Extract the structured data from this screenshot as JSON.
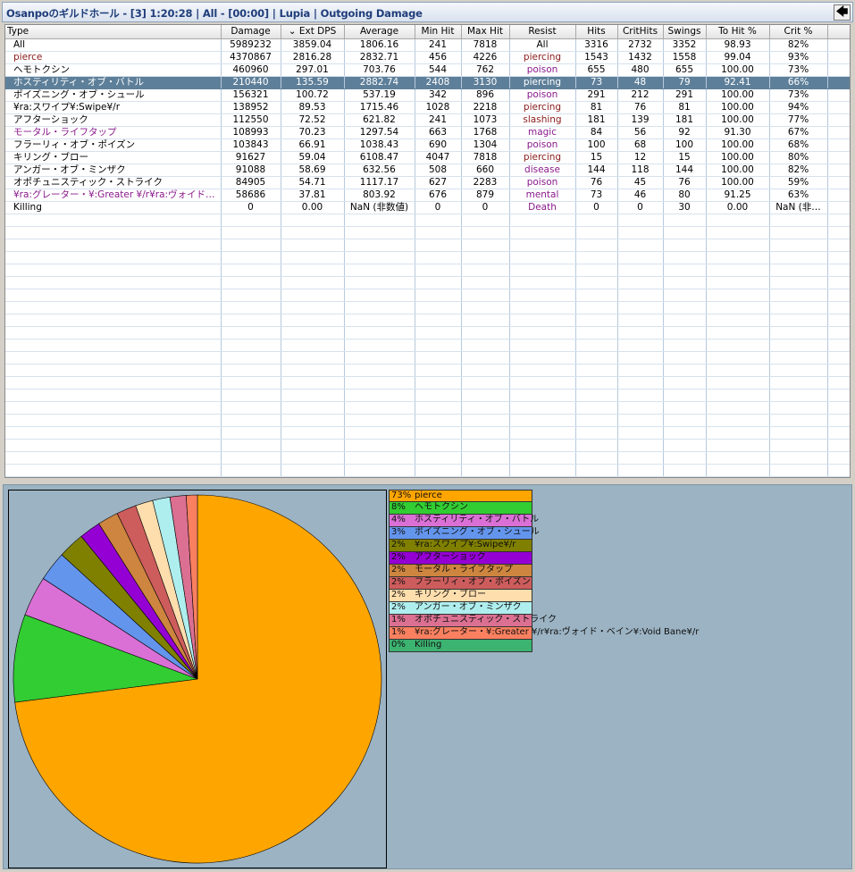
{
  "title": "Osanpoのギルドホール - [3] 1:20:28  | All - [00:00] | Lupia | Outgoing Damage",
  "back_glyph": "🡄",
  "columns": [
    {
      "label": "Type",
      "w": 241
    },
    {
      "label": "Damage",
      "w": 67
    },
    {
      "label": "⌄  Ext DPS",
      "w": 71
    },
    {
      "label": "Average",
      "w": 79
    },
    {
      "label": "Min Hit",
      "w": 52
    },
    {
      "label": "Max Hit",
      "w": 54
    },
    {
      "label": "Resist",
      "w": 74
    },
    {
      "label": "Hits",
      "w": 47
    },
    {
      "label": "CritHits",
      "w": 51
    },
    {
      "label": "Swings",
      "w": 48
    },
    {
      "label": "To Hit %",
      "w": 71
    },
    {
      "label": "Crit %",
      "w": 65
    },
    {
      "label": "",
      "w": 27
    }
  ],
  "rows": [
    {
      "cells": [
        "All",
        "5989232",
        "3859.04",
        "1806.16",
        "241",
        "7818",
        "All",
        "3316",
        "2732",
        "3352",
        "98.93",
        "82%"
      ],
      "name_color": "",
      "resist_color": ""
    },
    {
      "cells": [
        "pierce",
        "4370867",
        "2816.28",
        "2832.71",
        "456",
        "4226",
        "piercing",
        "1543",
        "1432",
        "1558",
        "99.04",
        "93%"
      ],
      "name_color": "maroon",
      "resist_color": "maroon"
    },
    {
      "cells": [
        "ヘモトクシン",
        "460960",
        "297.01",
        "703.76",
        "544",
        "762",
        "poison",
        "655",
        "480",
        "655",
        "100.00",
        "73%"
      ],
      "name_color": "",
      "resist_color": "purple"
    },
    {
      "cells": [
        "ホスティリティ・オブ・バトル",
        "210440",
        "135.59",
        "2882.74",
        "2408",
        "3130",
        "piercing",
        "73",
        "48",
        "79",
        "92.41",
        "66%"
      ],
      "name_color": "",
      "resist_color": "",
      "selected": true
    },
    {
      "cells": [
        "ポイズニング・オブ・シュール",
        "156321",
        "100.72",
        "537.19",
        "342",
        "896",
        "poison",
        "291",
        "212",
        "291",
        "100.00",
        "73%"
      ],
      "name_color": "",
      "resist_color": "purple"
    },
    {
      "cells": [
        "¥ra:スワイプ¥:Swipe¥/r",
        "138952",
        "89.53",
        "1715.46",
        "1028",
        "2218",
        "piercing",
        "81",
        "76",
        "81",
        "100.00",
        "94%"
      ],
      "name_color": "",
      "resist_color": "maroon"
    },
    {
      "cells": [
        "アフターショック",
        "112550",
        "72.52",
        "621.82",
        "241",
        "1073",
        "slashing",
        "181",
        "139",
        "181",
        "100.00",
        "77%"
      ],
      "name_color": "",
      "resist_color": "maroon"
    },
    {
      "cells": [
        "モータル・ライフタップ",
        "108993",
        "70.23",
        "1297.54",
        "663",
        "1768",
        "magic",
        "84",
        "56",
        "92",
        "91.30",
        "67%"
      ],
      "name_color": "purple",
      "resist_color": "purple"
    },
    {
      "cells": [
        "フラーリィ・オブ・ポイズン",
        "103843",
        "66.91",
        "1038.43",
        "690",
        "1304",
        "poison",
        "100",
        "68",
        "100",
        "100.00",
        "68%"
      ],
      "name_color": "",
      "resist_color": "purple"
    },
    {
      "cells": [
        "キリング・ブロー",
        "91627",
        "59.04",
        "6108.47",
        "4047",
        "7818",
        "piercing",
        "15",
        "12",
        "15",
        "100.00",
        "80%"
      ],
      "name_color": "",
      "resist_color": "maroon"
    },
    {
      "cells": [
        "アンガー・オブ・ミンザク",
        "91088",
        "58.69",
        "632.56",
        "508",
        "660",
        "disease",
        "144",
        "118",
        "144",
        "100.00",
        "82%"
      ],
      "name_color": "",
      "resist_color": "purple"
    },
    {
      "cells": [
        "オポチュニスティック・ストライク",
        "84905",
        "54.71",
        "1117.17",
        "627",
        "2283",
        "poison",
        "76",
        "45",
        "76",
        "100.00",
        "59%"
      ],
      "name_color": "",
      "resist_color": "purple"
    },
    {
      "cells": [
        "¥ra:グレーター・¥:Greater ¥/r¥ra:ヴォイド・ベイ…",
        "58686",
        "37.81",
        "803.92",
        "676",
        "879",
        "mental",
        "73",
        "46",
        "80",
        "91.25",
        "63%"
      ],
      "name_color": "purple",
      "resist_color": "purple"
    },
    {
      "cells": [
        "Killing",
        "0",
        "0.00",
        "NaN (非数値)",
        "0",
        "0",
        "Death",
        "0",
        "0",
        "30",
        "0.00",
        "NaN (非…"
      ],
      "name_color": "",
      "resist_color": "purple"
    }
  ],
  "empty_rows": 21,
  "colors": {
    "selected_row": "#5e7f99",
    "purple_text": "#8a1a8c",
    "maroon_text": "#8b1a1a",
    "panel_bg": "#9bb3c3"
  },
  "chart_data": {
    "type": "pie",
    "slices": [
      {
        "label": "pierce",
        "pct_label": "73%",
        "value": 4370867,
        "color": "#ffa500"
      },
      {
        "label": "ヘモトクシン",
        "pct_label": "8%",
        "value": 460960,
        "color": "#32cd32"
      },
      {
        "label": "ホスティリティ・オブ・バトル",
        "pct_label": "4%",
        "value": 210440,
        "color": "#da70d6"
      },
      {
        "label": "ポイズニング・オブ・シュール",
        "pct_label": "3%",
        "value": 156321,
        "color": "#6495ed"
      },
      {
        "label": "¥ra:スワイプ¥:Swipe¥/r",
        "pct_label": "2%",
        "value": 138952,
        "color": "#808000"
      },
      {
        "label": "アフターショック",
        "pct_label": "2%",
        "value": 112550,
        "color": "#9400d3"
      },
      {
        "label": "モータル・ライフタップ",
        "pct_label": "2%",
        "value": 108993,
        "color": "#cd853f"
      },
      {
        "label": "フラーリィ・オブ・ポイズン",
        "pct_label": "2%",
        "value": 103843,
        "color": "#cd5c5c"
      },
      {
        "label": "キリング・ブロー",
        "pct_label": "2%",
        "value": 91627,
        "color": "#ffdead"
      },
      {
        "label": "アンガー・オブ・ミンザク",
        "pct_label": "2%",
        "value": 91088,
        "color": "#afeeee"
      },
      {
        "label": "オポチュニスティック・ストライク",
        "pct_label": "1%",
        "value": 84905,
        "color": "#db7093"
      },
      {
        "label": "¥ra:グレーター・¥:Greater ¥/r¥ra:ヴォイド・ベイン¥:Void Bane¥/r",
        "pct_label": "1%",
        "value": 58686,
        "color": "#fa8060"
      },
      {
        "label": "Killing",
        "pct_label": "0%",
        "value": 0,
        "color": "#3cb371"
      }
    ]
  }
}
